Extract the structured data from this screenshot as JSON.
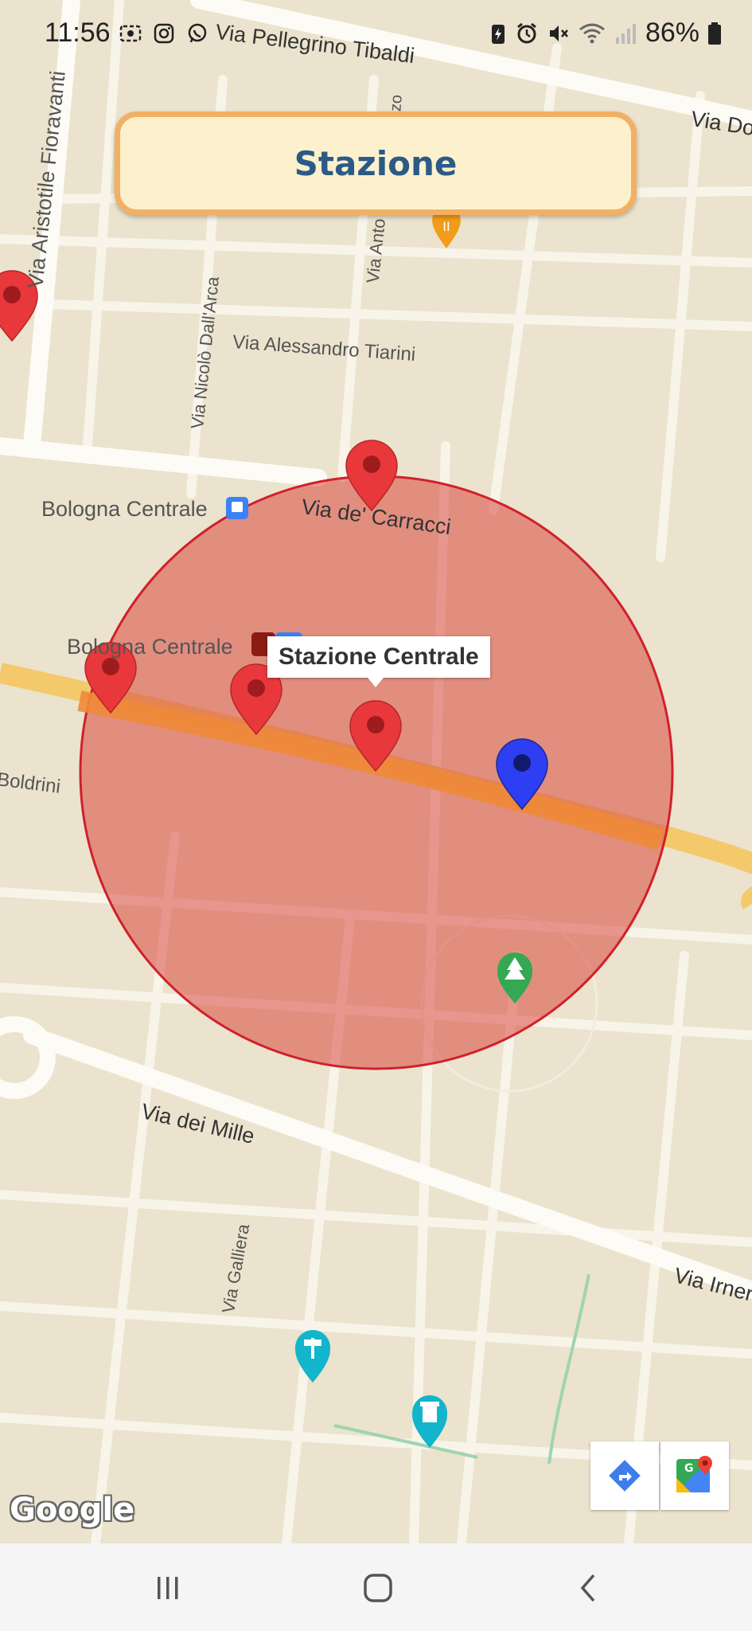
{
  "status_bar": {
    "time": "11:56",
    "battery": "86%"
  },
  "header": {
    "title": "Stazione"
  },
  "map": {
    "streets": [
      "Via Pellegrino Tibaldi",
      "Via Do",
      "Via Aristotile Fioravanti",
      "Via Anto",
      "Via Alessandro Tiarini",
      "Via Nicolò Dall'Arca",
      "Via de' Carracci",
      "Boldrini",
      "Via dei Mille",
      "Via Galliera",
      "Via Irner",
      "zo"
    ],
    "places": [
      "Bologna Centrale",
      "Bologna Centrale"
    ],
    "info_window": "Stazione Centrale",
    "attribution": "Google",
    "colors": {
      "circle_fill": "#e0847a",
      "circle_stroke": "#d1202a",
      "marker_red": "#e8383b",
      "marker_blue": "#2e3ef2"
    }
  },
  "controls": {
    "directions": "directions-icon",
    "open_maps": "google-maps-icon"
  },
  "nav": {
    "recents": "recents-icon",
    "home": "home-icon",
    "back": "back-icon"
  }
}
